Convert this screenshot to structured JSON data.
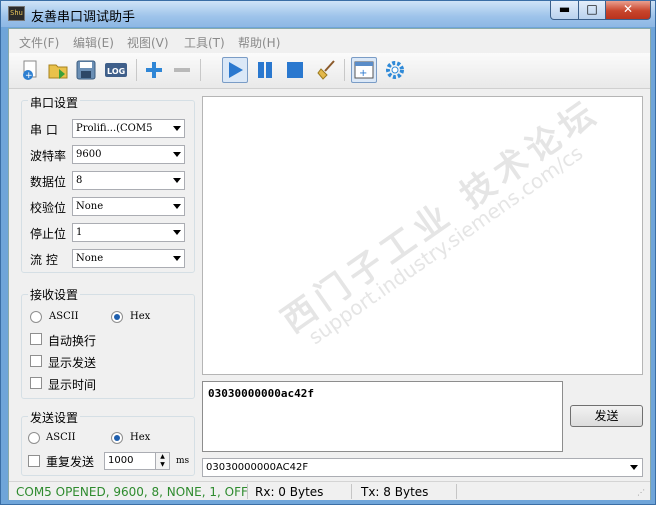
{
  "window": {
    "title": "友善串口调试助手",
    "icon_text": "Shu",
    "min": "▬",
    "max": "□",
    "close": "✕"
  },
  "menu": [
    {
      "label": "文件(F)"
    },
    {
      "label": "编辑(E)"
    },
    {
      "label": "视图(V)"
    },
    {
      "label": "工具(T)"
    },
    {
      "label": "帮助(H)"
    }
  ],
  "toolbar": {
    "items": [
      "new-file-icon",
      "open-folder-icon",
      "save-disk-icon",
      "log-icon",
      "add-icon",
      "remove-icon",
      "play-icon",
      "pause-icon",
      "stop-icon",
      "clear-broom-icon",
      "new-window-icon",
      "settings-gear-icon"
    ],
    "log_text": "LOG"
  },
  "serial_settings": {
    "title": "串口设置",
    "port_label": "串  口",
    "port_value": "Prolifi...(COM5",
    "baud_label": "波特率",
    "baud_value": "9600",
    "databits_label": "数据位",
    "databits_value": "8",
    "parity_label": "校验位",
    "parity_value": "None",
    "stopbits_label": "停止位",
    "stopbits_value": "1",
    "flow_label": "流  控",
    "flow_value": "None"
  },
  "receive_settings": {
    "title": "接收设置",
    "ascii_label": "ASCII",
    "hex_label": "Hex",
    "selected": "Hex",
    "auto_wrap": "自动换行",
    "show_send": "显示发送",
    "show_time": "显示时间"
  },
  "send_settings": {
    "title": "发送设置",
    "ascii_label": "ASCII",
    "hex_label": "Hex",
    "selected": "Hex",
    "repeat_label": "重复发送",
    "repeat_interval": "1000",
    "unit": "ms"
  },
  "send_text": "03030000000ac42f",
  "send_button": "发送",
  "history_value": "03030000000AC42F",
  "status": {
    "connection": "COM5 OPENED, 9600, 8, NONE, 1, OFF",
    "rx": "Rx: 0 Bytes",
    "tx": "Tx: 8 Bytes"
  },
  "watermark": {
    "line1": "西门子工业  技术论坛",
    "line2": "support.industry.siemens.com/cs"
  },
  "colors": {
    "accent": "#1f6fcf",
    "status_ok": "#2e8b2e",
    "title_bar": "#9dc3ea"
  }
}
